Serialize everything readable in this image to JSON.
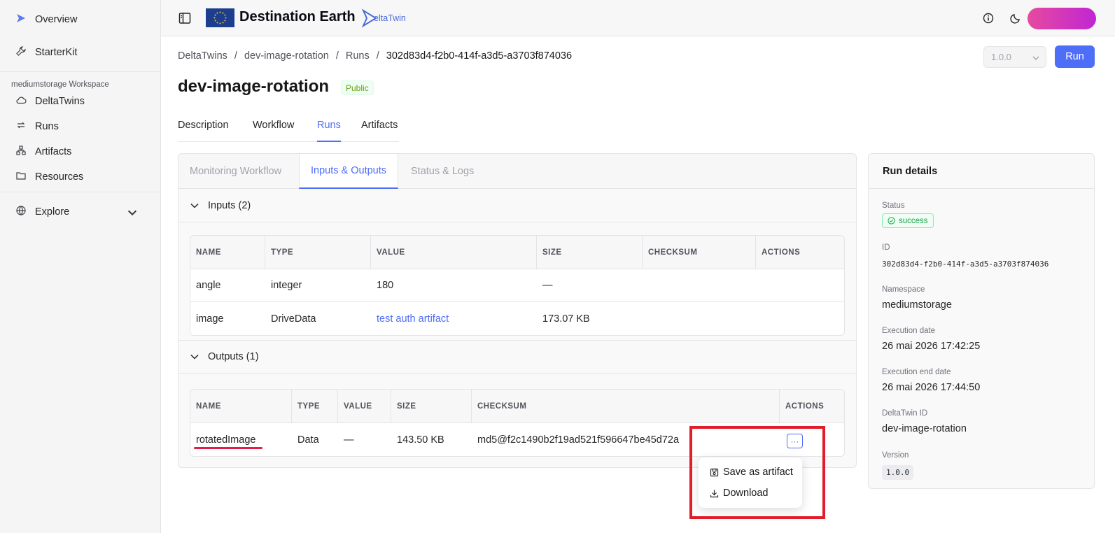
{
  "sidebar": {
    "top_items": [
      {
        "label": "Overview",
        "icon": "deltatwin-logo-icon"
      },
      {
        "label": "StarterKit",
        "icon": "wrench-icon"
      }
    ],
    "workspace_label": "mediumstorage Workspace",
    "workspace_items": [
      {
        "label": "DeltaTwins",
        "icon": "cloud-icon"
      },
      {
        "label": "Runs",
        "icon": "repeat-icon"
      },
      {
        "label": "Artifacts",
        "icon": "network-icon"
      },
      {
        "label": "Resources",
        "icon": "folder-icon"
      }
    ],
    "explore": {
      "label": "Explore",
      "icon": "globe-icon"
    }
  },
  "header": {
    "brand": "Destination Earth",
    "deltatwin_logo_text": "eltaTwin",
    "colors": {
      "brand_gradient_start": "#e64a9e",
      "brand_gradient_end": "#c026d3",
      "accent": "#4f6ef7"
    }
  },
  "breadcrumb": [
    "DeltaTwins",
    "dev-image-rotation",
    "Runs",
    "302d83d4-f2b0-414f-a3d5-a3703f874036"
  ],
  "version_select": "1.0.0",
  "run_button": "Run",
  "page": {
    "title": "dev-image-rotation",
    "visibility_badge": "Public"
  },
  "main_tabs": [
    {
      "label": "Description",
      "active": false
    },
    {
      "label": "Workflow",
      "active": false
    },
    {
      "label": "Runs",
      "active": true
    },
    {
      "label": "Artifacts",
      "active": false
    }
  ],
  "sub_tabs": [
    {
      "label": "Monitoring Workflow",
      "active": false
    },
    {
      "label": "Inputs & Outputs",
      "active": true
    },
    {
      "label": "Status & Logs",
      "active": false
    }
  ],
  "inputs": {
    "heading": "Inputs (2)",
    "columns": [
      "NAME",
      "TYPE",
      "VALUE",
      "SIZE",
      "CHECKSUM",
      "ACTIONS"
    ],
    "rows": [
      {
        "name": "angle",
        "type": "integer",
        "value": "180",
        "size": "—",
        "checksum": "",
        "actions": ""
      },
      {
        "name": "image",
        "type": "DriveData",
        "value": "test auth artifact",
        "size": "173.07 KB",
        "checksum": "",
        "actions": ""
      }
    ]
  },
  "outputs": {
    "heading": "Outputs (1)",
    "columns": [
      "NAME",
      "TYPE",
      "VALUE",
      "SIZE",
      "CHECKSUM",
      "ACTIONS"
    ],
    "rows": [
      {
        "name": "rotatedImage",
        "type": "Data",
        "value": "—",
        "size": "143.50 KB",
        "checksum": "md5@f2c1490b2f19ad521f596647be45d72a"
      }
    ],
    "actions_button": "···",
    "menu": [
      {
        "label": "Save as artifact",
        "icon": "save-icon"
      },
      {
        "label": "Download",
        "icon": "download-icon"
      }
    ]
  },
  "run_details": {
    "title": "Run details",
    "status_label": "Status",
    "status_value": "success",
    "id_label": "ID",
    "id_value": "302d83d4-f2b0-414f-a3d5-a3703f874036",
    "namespace_label": "Namespace",
    "namespace_value": "mediumstorage",
    "exec_date_label": "Execution date",
    "exec_date_value": "26 mai 2026 17:42:25",
    "exec_end_label": "Execution end date",
    "exec_end_value": "26 mai 2026 17:44:50",
    "deltatwin_id_label": "DeltaTwin ID",
    "deltatwin_id_value": "dev-image-rotation",
    "version_label": "Version",
    "version_value": "1.0.0"
  }
}
